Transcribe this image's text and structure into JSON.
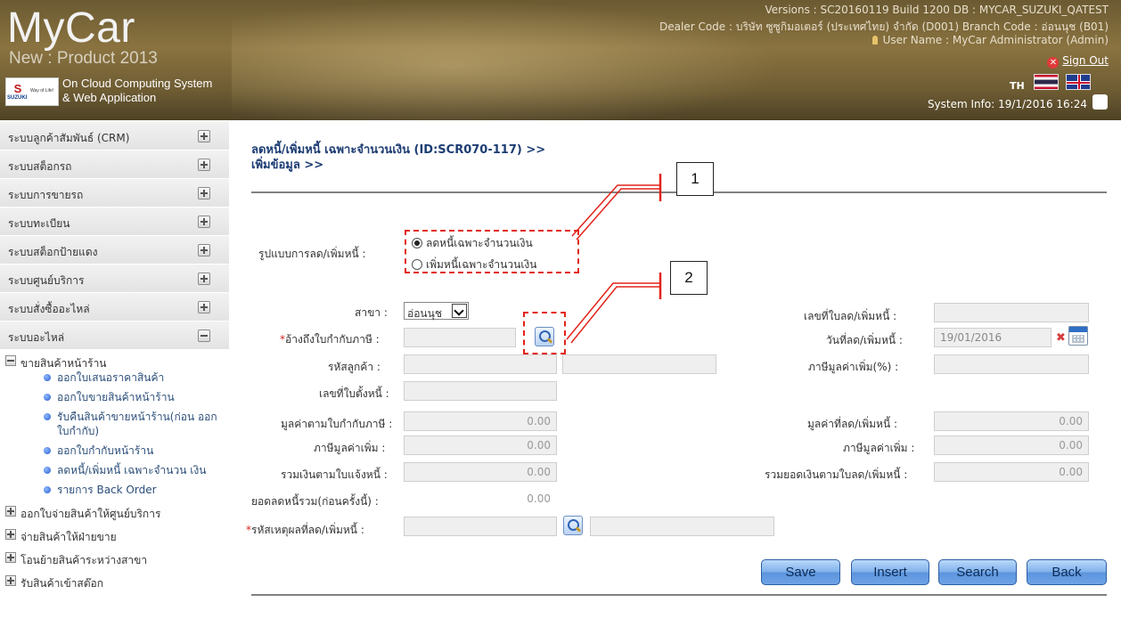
{
  "header": {
    "app_name": "MyCar",
    "subtitle": "New : Product 2013",
    "brand_mark": "S",
    "brand_name": "SUZUKI",
    "brand_tagline": "Way of Life!",
    "cloud_line1": "On Cloud Computing System",
    "cloud_line2": "& Web Application",
    "versions": "Versions : SC20160119 Build 1200 DB : MYCAR_SUZUKI_QATEST",
    "dealer": "Dealer Code : บริษัท ซูซูกิมอเตอร์ (ประเทศไทย) จำกัด (D001)  Branch Code : อ่อนนุช (B01)",
    "user": "User Name : MyCar Administrator  (Admin)",
    "sign_out": "Sign Out",
    "lang": "TH",
    "system_info": "System Info: 19/1/2016 16:24"
  },
  "sidebar": {
    "menus": [
      {
        "label": "ระบบลูกค้าสัมพันธ์ (CRM)",
        "expanded": false
      },
      {
        "label": "ระบบสต็อกรถ",
        "expanded": false
      },
      {
        "label": "ระบบการขายรถ",
        "expanded": false
      },
      {
        "label": "ระบบทะเบียน",
        "expanded": false
      },
      {
        "label": "ระบบสต็อกป้ายแดง",
        "expanded": false
      },
      {
        "label": "ระบบศูนย์บริการ",
        "expanded": false
      },
      {
        "label": "ระบบสั่งซื้ออะไหล่",
        "expanded": false
      },
      {
        "label": "ระบบอะไหล่",
        "expanded": true
      }
    ],
    "tree": {
      "node1": "ขายสินค้าหน้าร้าน",
      "leaves": [
        "ออกใบเสนอราคาสินค้า",
        "ออกใบขายสินค้าหน้าร้าน",
        "รับคืนสินค้าขายหน้าร้าน(ก่อน ออกใบกำกับ)",
        "ออกใบกำกับหน้าร้าน",
        "ลดหนี้/เพิ่มหนี้ เฉพาะจำนวน เงิน",
        "รายการ Back Order"
      ],
      "node2": "ออกใบจ่ายสินค้าให้ศูนย์บริการ",
      "node3": "จ่ายสินค้าให้ฝ่ายขาย",
      "node4": "โอนย้ายสินค้าระหว่างสาขา",
      "node5": "รับสินค้าเข้าสต๊อก"
    }
  },
  "page": {
    "title_line1": "ลดหนี้/เพิ่มหนี้ เฉพาะจำนวนเงิน (ID:SCR070-117) >>",
    "title_line2": "เพิ่มข้อมูล >>"
  },
  "form": {
    "type_label": "รูปแบบการลด/เพิ่มหนี้ :",
    "option1": "ลดหนี้เฉพาะจำนวนเงิน",
    "option2": "เพิ่มหนี้เฉพาะจำนวนเงิน",
    "selected_option": 1,
    "branch_label": "สาขา :",
    "branch_value": "อ่อนนุช",
    "tax_invoice_ref_label": "อ้างถึงใบกำกับภาษี :",
    "customer_code_label": "รหัสลูกค้า :",
    "debt_doc_label": "เลขที่ใบตั้งหนี้ :",
    "invoice_value_label": "มูลค่าตามใบกำกับภาษี :",
    "invoice_value": "0.00",
    "vat_label_left": "ภาษีมูลค่าเพิ่ม :",
    "vat_value_left": "0.00",
    "total_notice_label": "รวมเงินตามใบแจ้งหนี้ :",
    "total_notice_value": "0.00",
    "prev_reduce_label": "ยอดลดหนี้รวม(ก่อนครั้งนี้) :",
    "prev_reduce_value": "0.00",
    "reason_code_label": "รหัสเหตุผลที่ลด/เพิ่มหนี้ :",
    "doc_no_label": "เลขที่ใบลด/เพิ่มหนี้ :",
    "date_label": "วันที่ลด/เพิ่มหนี้ :",
    "date_value": "19/01/2016",
    "vat_percent_label": "ภาษีมูลค่าเพิ่ม(%) :",
    "adj_value_label": "มูลค่าที่ลด/เพิ่มหนี้ :",
    "adj_value": "0.00",
    "vat_label_right": "ภาษีมูลค่าเพิ่ม :",
    "vat_value_right": "0.00",
    "total_adj_label": "รวมยอดเงินตามใบลด/เพิ่มหนี้ :",
    "total_adj_value": "0.00"
  },
  "buttons": {
    "save": "Save",
    "insert": "Insert",
    "search": "Search",
    "back": "Back"
  },
  "callouts": [
    "1",
    "2"
  ],
  "colors": {
    "title": "#1d3d73",
    "callout_line": "#e2231a",
    "button": "#6ea3e6"
  }
}
